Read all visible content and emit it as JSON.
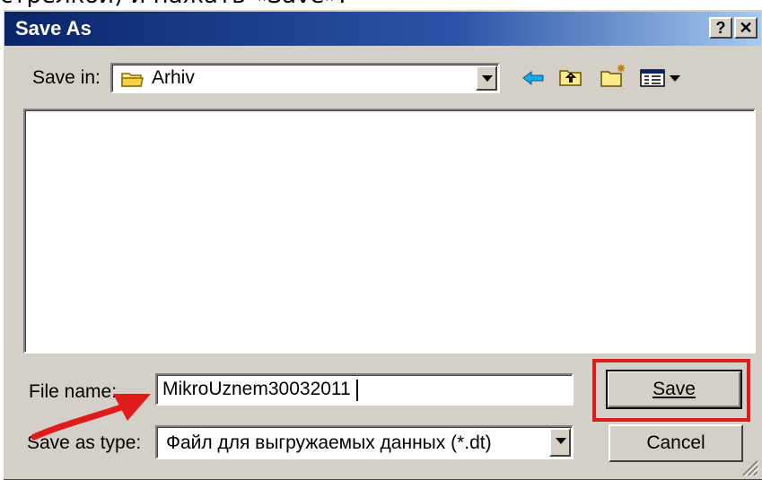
{
  "caption": "стрелкой) и нажать «Save».",
  "window": {
    "title": "Save As",
    "help_label": "?",
    "close_label": "✕"
  },
  "toolbar": {
    "save_in_label": "Save in:",
    "save_in_value": "Arhiv"
  },
  "form": {
    "file_name_label": "File name:",
    "file_name_value": "MikroUznem30032011",
    "save_as_type_label": "Save as type:",
    "save_as_type_value": "Файл для выгружаемых данных (*.dt)"
  },
  "buttons": {
    "save_label": "Save",
    "cancel_label": "Cancel"
  },
  "colors": {
    "annotation_red": "#e01b1b",
    "title_blue": "#0a246a",
    "dialog_gray": "#d4d0c8"
  },
  "icons": [
    "folder-icon",
    "back-arrow-icon",
    "up-folder-icon",
    "new-folder-icon",
    "view-menu-icon",
    "chevron-down-icon",
    "resize-grip-icon",
    "annotation-arrow-icon"
  ]
}
